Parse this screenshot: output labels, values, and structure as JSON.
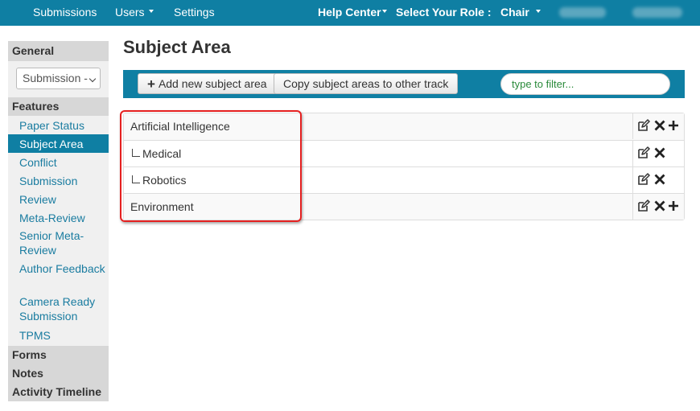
{
  "topbar": {
    "submissions": "Submissions",
    "users": "Users",
    "settings": "Settings",
    "help_center": "Help Center",
    "select_role": "Select Your Role :",
    "role": "Chair"
  },
  "sidebar": {
    "general": "General",
    "select_value": "Submission -",
    "features": "Features",
    "items": [
      {
        "label": "Paper Status",
        "lines": 1
      },
      {
        "label": "Subject Area",
        "lines": 1,
        "active": true
      },
      {
        "label": "Conflict",
        "lines": 1
      },
      {
        "label": "Submission",
        "lines": 1
      },
      {
        "label": "Review",
        "lines": 1
      },
      {
        "label": "Meta-Review",
        "lines": 1
      },
      {
        "label": "Senior Meta-Review",
        "lines": 2
      },
      {
        "label": "Author Feedback",
        "lines": 2
      },
      {
        "label": "Camera Ready Submission",
        "lines": 2
      },
      {
        "label": "TPMS",
        "lines": 1
      }
    ],
    "sections": [
      "Forms",
      "Notes",
      "Activity Timeline"
    ]
  },
  "main": {
    "title": "Subject Area",
    "add_button": "Add new subject area",
    "copy_button": "Copy subject areas to other track",
    "filter_placeholder": "type to filter...",
    "rows": [
      {
        "label": "Artificial Intelligence",
        "level": 0,
        "icons": [
          "edit-icon",
          "delete-icon",
          "add-icon"
        ]
      },
      {
        "label": "Medical",
        "level": 1,
        "icons": [
          "edit-icon",
          "delete-icon"
        ]
      },
      {
        "label": "Robotics",
        "level": 1,
        "icons": [
          "edit-icon",
          "delete-icon"
        ]
      },
      {
        "label": "Environment",
        "level": 0,
        "icons": [
          "edit-icon",
          "delete-icon",
          "add-icon"
        ]
      }
    ]
  },
  "colors": {
    "brand": "#0f7fa3",
    "link": "#1a7ca0",
    "highlight": "#e52020",
    "filter_text": "#2a8a3a"
  }
}
